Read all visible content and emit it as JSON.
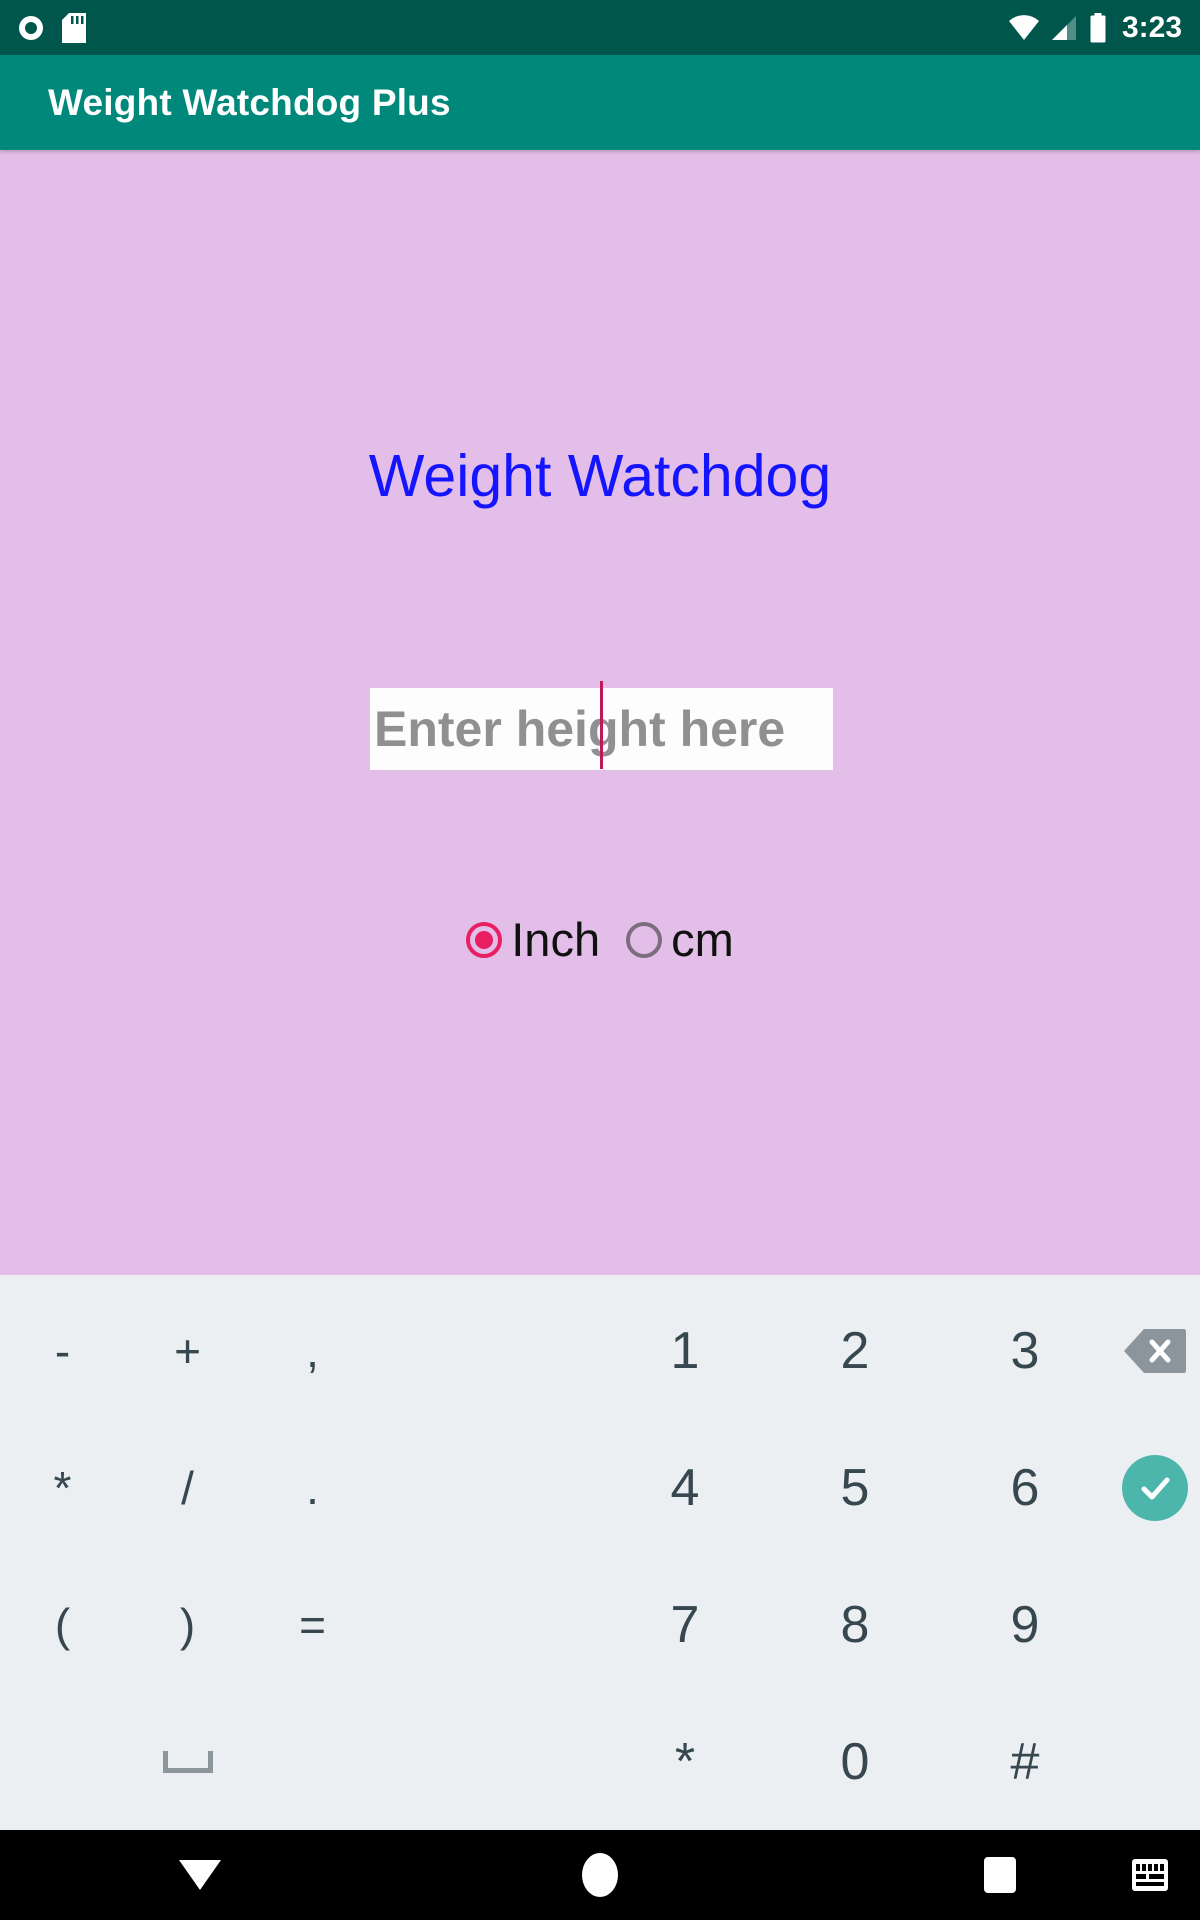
{
  "status_bar": {
    "time": "3:23",
    "left_icons": [
      "screen-record-icon",
      "sd-card-icon"
    ],
    "right_icons": [
      "wifi-icon",
      "signal-icon",
      "battery-icon"
    ],
    "background_color": "#00564a"
  },
  "app_bar": {
    "title": "Weight Watchdog Plus",
    "background_color": "#00897b",
    "text_color": "#ffffff"
  },
  "content": {
    "background_color": "#e3bee8",
    "headline": "Weight Watchdog",
    "headline_color": "#1414ff",
    "height_input": {
      "placeholder": "Enter height here",
      "value": "",
      "caret_color": "#c2185b",
      "background_color": "#fdfdfd"
    },
    "unit_options": [
      {
        "label": "Inch",
        "selected": true
      },
      {
        "label": "cm",
        "selected": false
      }
    ],
    "selected_unit": "Inch",
    "accent_color": "#e91e63",
    "submit_button": {
      "label": "",
      "icon": "arrow-right-icon",
      "background_color": "#ffc107",
      "icon_color": "#556b1a"
    }
  },
  "keyboard": {
    "background_color": "#eceff1",
    "key_text_color": "#37474f",
    "rows": [
      {
        "left": [
          "-",
          "+",
          ","
        ],
        "right": [
          "1",
          "2",
          "3"
        ],
        "action": "backspace-key"
      },
      {
        "left": [
          "*",
          "/",
          "."
        ],
        "right": [
          "4",
          "5",
          "6"
        ],
        "action": "enter-key"
      },
      {
        "left": [
          "(",
          ")",
          "="
        ],
        "right": [
          "7",
          "8",
          "9"
        ],
        "action": ""
      },
      {
        "left": [
          "",
          "space",
          ""
        ],
        "right": [
          "*",
          "0",
          "#"
        ],
        "action": ""
      }
    ],
    "enter_key_color": "#4db6ac",
    "backspace_key_color": "#8b959b"
  },
  "nav_bar": {
    "background_color": "#000000",
    "buttons": [
      "hide-keyboard-icon",
      "home-icon",
      "recents-icon"
    ],
    "keyboard_switch_icon": "keyboard-switch-icon"
  }
}
